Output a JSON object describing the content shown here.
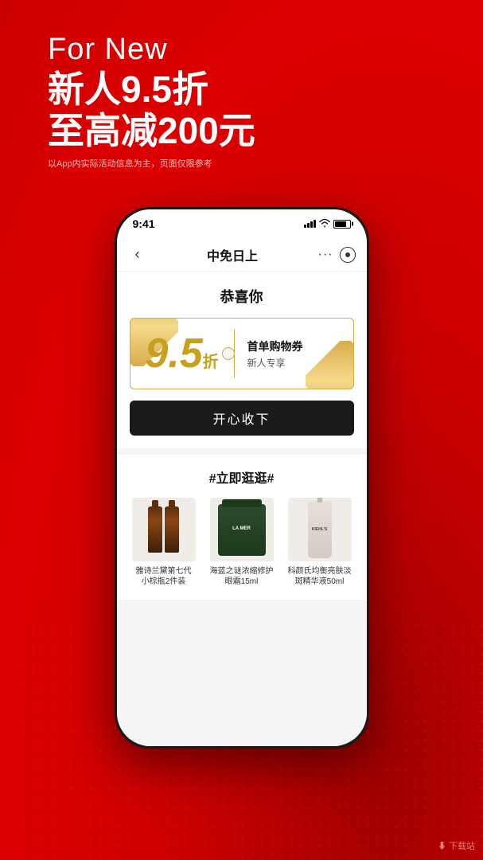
{
  "background": {
    "color": "#cc0000"
  },
  "header": {
    "for_new_label": "For New",
    "discount_line1": "新人9.5折",
    "discount_line2": "至高减200元",
    "note": "以App内实际活动信息为主，页面仅限参考"
  },
  "status_bar": {
    "time": "9:41"
  },
  "nav": {
    "back_icon": "‹",
    "title": "中免日上",
    "more_icon": "···"
  },
  "coupon_section": {
    "congrats": "恭喜你",
    "discount_number": "9.5",
    "discount_unit": "折",
    "label1": "首单购物券",
    "label2": "新人专享",
    "collect_button": "开心收下"
  },
  "browse_section": {
    "title": "#立即逛逛#",
    "products": [
      {
        "id": 1,
        "name": "雅诗兰黛第七代\n小棕瓶2件装",
        "type": "bottles"
      },
      {
        "id": 2,
        "name": "海蓝之谜浓缩修护\n眼霜15ml",
        "type": "jar"
      },
      {
        "id": 3,
        "name": "科颜氏均衡亮肤淡\n斑精华液50ml",
        "type": "dropper"
      }
    ]
  },
  "watermark": {
    "text": "下载站"
  }
}
